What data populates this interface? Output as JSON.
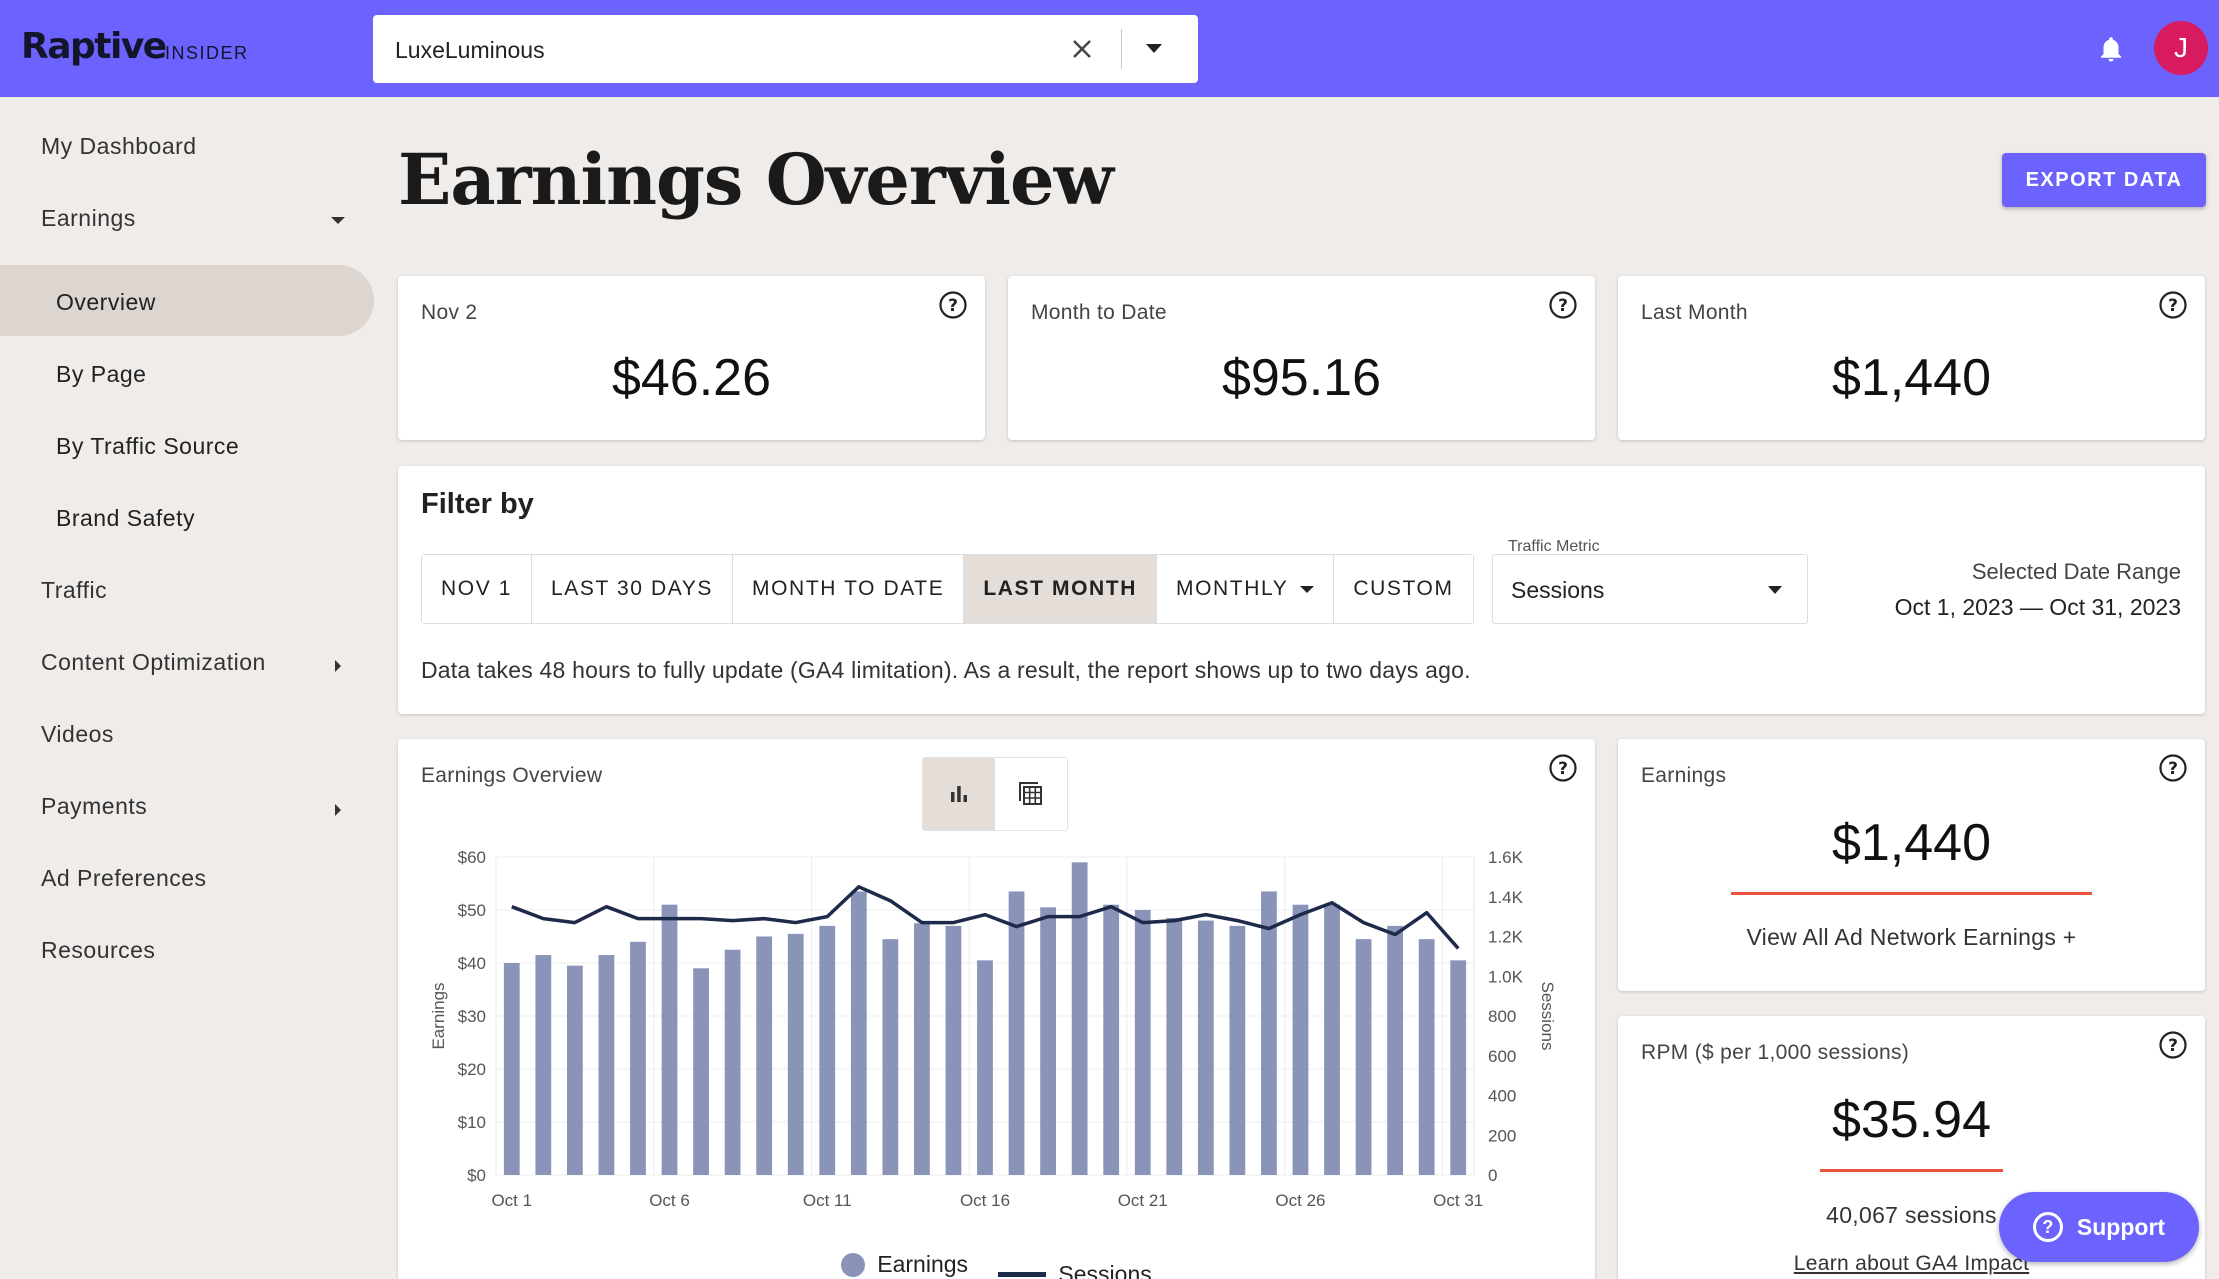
{
  "header": {
    "logo": "Raptive",
    "logo_sub": "INSIDER",
    "site_value": "LuxeLuminous",
    "avatar_initial": "J"
  },
  "sidebar": {
    "items": [
      {
        "label": "My Dashboard"
      },
      {
        "label": "Earnings"
      },
      {
        "label": "Overview"
      },
      {
        "label": "By Page"
      },
      {
        "label": "By Traffic Source"
      },
      {
        "label": "Brand Safety"
      },
      {
        "label": "Traffic"
      },
      {
        "label": "Content Optimization"
      },
      {
        "label": "Videos"
      },
      {
        "label": "Payments"
      },
      {
        "label": "Ad Preferences"
      },
      {
        "label": "Resources"
      }
    ]
  },
  "page": {
    "title": "Earnings Overview",
    "export_label": "EXPORT DATA"
  },
  "stats": [
    {
      "label": "Nov 2",
      "value": "$46.26"
    },
    {
      "label": "Month to Date",
      "value": "$95.16"
    },
    {
      "label": "Last Month",
      "value": "$1,440"
    }
  ],
  "filter": {
    "title": "Filter by",
    "buttons": [
      "NOV 1",
      "LAST 30 DAYS",
      "MONTH TO DATE",
      "LAST MONTH",
      "MONTHLY",
      "CUSTOM"
    ],
    "active": "LAST MONTH",
    "metric_label": "Traffic Metric",
    "metric_value": "Sessions",
    "range_label": "Selected Date Range",
    "range_value": "Oct 1, 2023 — Oct 31, 2023",
    "note": "Data takes 48 hours to fully update (GA4 limitation). As a result, the report shows up to two days ago."
  },
  "chart_card": {
    "title": "Earnings Overview"
  },
  "chart_data": {
    "type": "bar",
    "title": "Earnings Overview",
    "categories": [
      "Oct 1",
      "Oct 2",
      "Oct 3",
      "Oct 4",
      "Oct 5",
      "Oct 6",
      "Oct 7",
      "Oct 8",
      "Oct 9",
      "Oct 10",
      "Oct 11",
      "Oct 12",
      "Oct 13",
      "Oct 14",
      "Oct 15",
      "Oct 16",
      "Oct 17",
      "Oct 18",
      "Oct 19",
      "Oct 20",
      "Oct 21",
      "Oct 22",
      "Oct 23",
      "Oct 24",
      "Oct 25",
      "Oct 26",
      "Oct 27",
      "Oct 28",
      "Oct 29",
      "Oct 30",
      "Oct 31"
    ],
    "x_tick_labels": [
      "Oct 1",
      "Oct 6",
      "Oct 11",
      "Oct 16",
      "Oct 21",
      "Oct 26",
      "Oct 31"
    ],
    "series": [
      {
        "name": "Earnings",
        "type": "bar",
        "axis": "left",
        "values": [
          40,
          41.5,
          39.5,
          41.5,
          44,
          51,
          39,
          42.5,
          45,
          45.5,
          47,
          53.5,
          44.5,
          47.5,
          47,
          40.5,
          53.5,
          50.5,
          59,
          51,
          50,
          48.5,
          48,
          47,
          53.5,
          51,
          51,
          44.5,
          47,
          44.5,
          40.5
        ]
      },
      {
        "name": "Sessions",
        "type": "line",
        "axis": "right",
        "values": [
          1350,
          1290,
          1270,
          1350,
          1290,
          1290,
          1290,
          1280,
          1290,
          1270,
          1300,
          1450,
          1380,
          1270,
          1270,
          1310,
          1250,
          1300,
          1300,
          1350,
          1270,
          1280,
          1310,
          1280,
          1240,
          1310,
          1370,
          1270,
          1210,
          1320,
          1140
        ]
      }
    ],
    "ylabel": "Earnings",
    "y2label": "Sessions",
    "ylim": [
      0,
      60
    ],
    "y2lim": [
      0,
      1600
    ],
    "y_ticks": [
      "$0",
      "$10",
      "$20",
      "$30",
      "$40",
      "$50",
      "$60"
    ],
    "y2_ticks": [
      "0",
      "200",
      "400",
      "600",
      "800",
      "1.0K",
      "1.2K",
      "1.4K",
      "1.6K"
    ],
    "legend": [
      "Earnings",
      "Sessions"
    ],
    "colors": {
      "bar": "#8a93b8",
      "line": "#1e2a4a"
    },
    "grid": true
  },
  "earnings_card": {
    "label": "Earnings",
    "value": "$1,440",
    "link": "View All Ad Network Earnings +"
  },
  "rpm_card": {
    "label": "RPM ($ per 1,000 sessions)",
    "value": "$35.94",
    "sessions": "40,067 sessions",
    "link": "Learn about GA4 Impact"
  },
  "support": {
    "label": "Support"
  }
}
